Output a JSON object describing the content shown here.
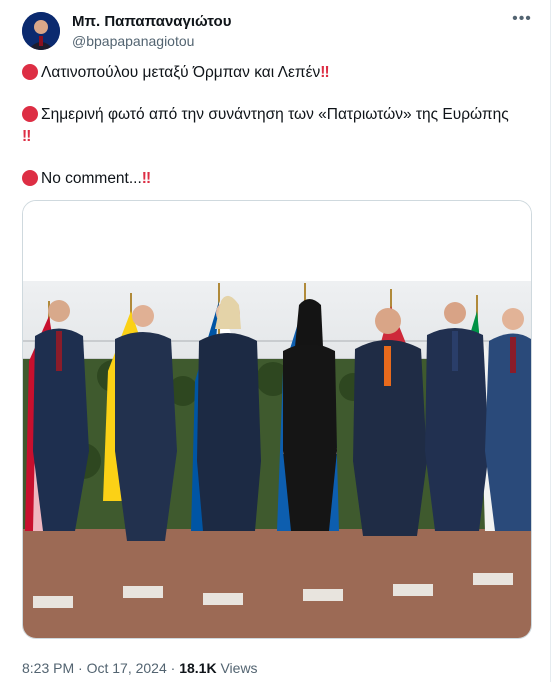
{
  "author": {
    "name": "Μπ. Παπαπαναγιώτου",
    "handle": "@bpapapanagiotou"
  },
  "more_label": "•••",
  "tweet": {
    "line1": "Λατινοπούλου μεταξύ Όρμπαν και Λεπέν",
    "line2": "Σημερινή φωτό από την συνάντηση των «Πατριωτών» της Ευρώπης",
    "line3": "No comment...",
    "bang": "‼"
  },
  "meta": {
    "time": "8:23 PM",
    "sep": "·",
    "date": "Oct 17, 2024",
    "views_count": "18.1K",
    "views_label": "Views"
  },
  "colors": {
    "accent_red": "#dd2e44",
    "secondary_text": "#536471"
  }
}
